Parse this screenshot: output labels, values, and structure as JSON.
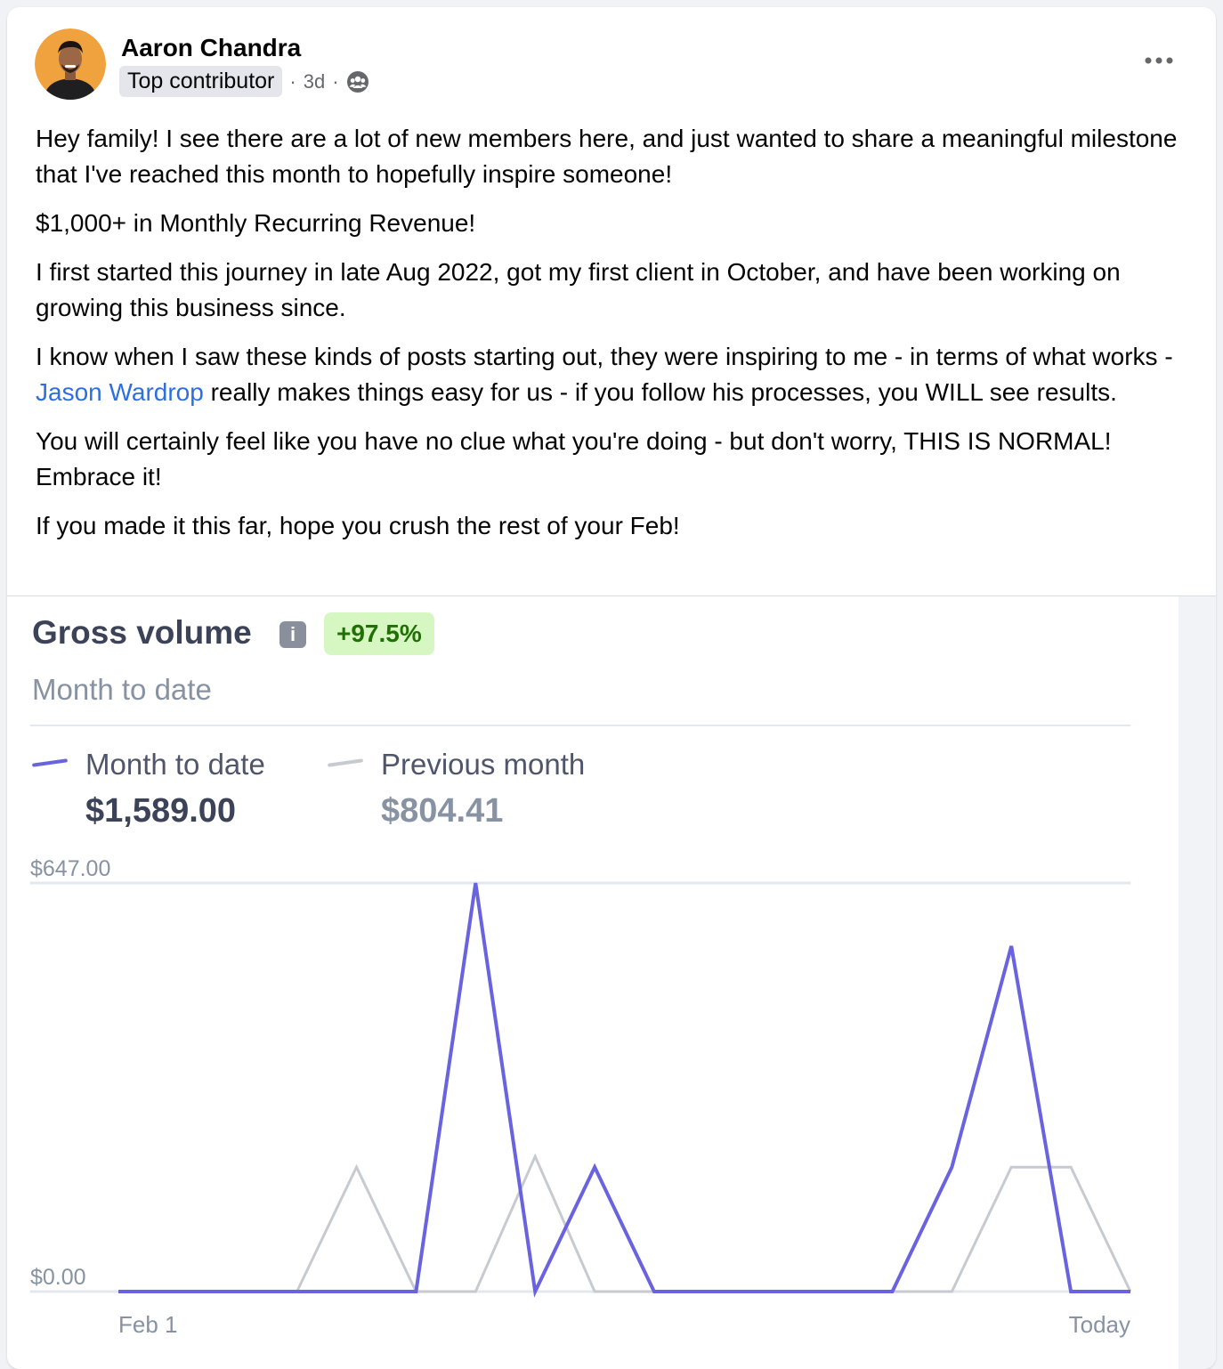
{
  "post": {
    "author": {
      "name": "Aaron Chandra",
      "badge": "Top contributor",
      "time": "3d",
      "separator": "·"
    },
    "audience_icon": "group-icon",
    "menu_icon": "more-horizontal-icon",
    "paragraphs": [
      "Hey family! I see there are a lot of new members here, and just wanted to share a meaningful milestone that I've reached this month to hopefully inspire someone!",
      "$1,000+ in Monthly Recurring Revenue!",
      "I first started this journey in late Aug 2022, got my first client in October, and have been working on growing this business since."
    ],
    "p4_before": "I know when I saw these kinds of posts starting out, they were inspiring to me - in terms of what works - ",
    "p4_mention": "Jason Wardrop",
    "p4_after": " really makes things easy for us - if you follow his processes, you WILL see results.",
    "paragraphs_end": [
      "You will certainly feel like you have no clue what you're doing - but don't worry, THIS IS NORMAL! Embrace it!",
      "If you made it this far, hope you crush the rest of your Feb!"
    ]
  },
  "attachment": {
    "title": "Gross volume",
    "info_icon": "info-icon",
    "change": "+97.5%",
    "subtitle": "Month to date",
    "legend": [
      {
        "label": "Month to date",
        "value": "$1,589.00",
        "color": "#6a63e0"
      },
      {
        "label": "Previous month",
        "value": "$804.41",
        "color": "#c7cad1"
      }
    ],
    "colors": {
      "title": "#3c4257",
      "change_bg": "#d7f7c2",
      "change_text": "#217005",
      "accent": "#6a63e0",
      "previous": "#c7cad1"
    }
  },
  "chart_data": {
    "type": "line",
    "x": [
      "Feb 1",
      "",
      "",
      "",
      "",
      "",
      "",
      "",
      "",
      "",
      "",
      "",
      "",
      "",
      "",
      "",
      "",
      "Today"
    ],
    "series": [
      {
        "name": "Month to date",
        "values": [
          0,
          0,
          0,
          0,
          0,
          0,
          647,
          0,
          197,
          0,
          0,
          0,
          0,
          0,
          197,
          547,
          0,
          0
        ]
      },
      {
        "name": "Previous month",
        "values": [
          0,
          0,
          0,
          0,
          197,
          0,
          0,
          214,
          0,
          0,
          0,
          0,
          0,
          0,
          0,
          197,
          197,
          0
        ]
      }
    ],
    "y_tick_labels": [
      "$0.00",
      "$647.00"
    ],
    "x_tick_labels": [
      "Feb 1",
      "Today"
    ],
    "ylim": [
      0,
      647
    ],
    "grid": false
  }
}
